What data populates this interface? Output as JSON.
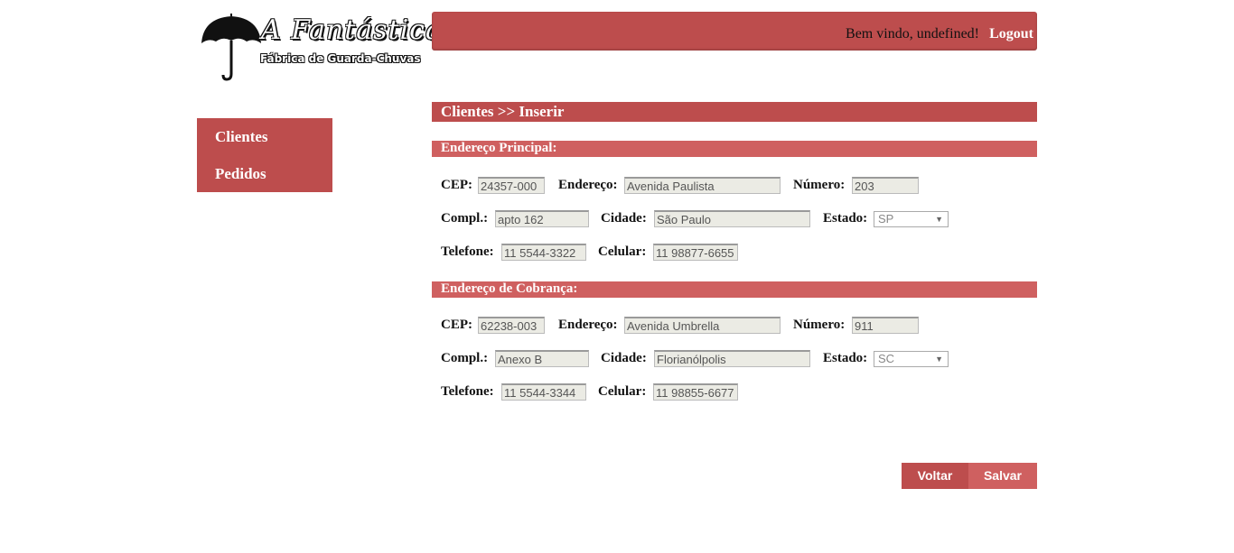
{
  "logo": {
    "title": "A Fantástica",
    "subtitle": "Fábrica de Guarda-Chuvas"
  },
  "header": {
    "welcome": "Bem vindo, undefined!",
    "logout": "Logout"
  },
  "sidebar": {
    "items": [
      {
        "label": "Clientes"
      },
      {
        "label": "Pedidos"
      }
    ]
  },
  "page": {
    "title": "Clientes >> Inserir"
  },
  "labels": {
    "cep": "CEP:",
    "endereco": "Endereço:",
    "numero": "Número:",
    "compl": "Compl.:",
    "cidade": "Cidade:",
    "estado": "Estado:",
    "telefone": "Telefone:",
    "celular": "Celular:"
  },
  "principal": {
    "heading": "Endereço Principal:",
    "cep": "24357-000",
    "endereco": "Avenida Paulista",
    "numero": "203",
    "compl": "apto 162",
    "cidade": "São Paulo",
    "estado": "SP",
    "telefone": "11 5544-3322",
    "celular": "11 98877-6655"
  },
  "cobranca": {
    "heading": "Endereço de Cobrança:",
    "cep": "62238-003",
    "endereco": "Avenida Umbrella",
    "numero": "911",
    "compl": "Anexo B",
    "cidade": "Florianólpolis",
    "estado": "SC",
    "telefone": "11 5544-3344",
    "celular": "11 98855-6677"
  },
  "buttons": {
    "voltar": "Voltar",
    "salvar": "Salvar"
  },
  "colors": {
    "primary": "#bd4d4d",
    "secondary": "#cf6060"
  },
  "icons": {
    "logo": "umbrella-icon",
    "select": "chevron-down-icon"
  }
}
